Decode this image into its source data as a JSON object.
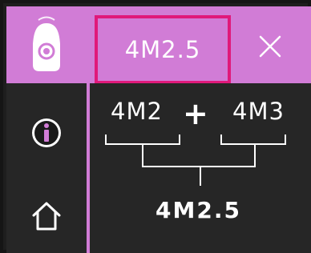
{
  "header": {
    "current_value": "4M2.5"
  },
  "sidebar": {
    "items": [
      {
        "name": "device-mode",
        "icon": "device-icon",
        "active": true
      },
      {
        "name": "info",
        "icon": "info-icon",
        "active": false
      },
      {
        "name": "home",
        "icon": "home-icon",
        "active": false
      }
    ]
  },
  "calculation": {
    "term_left": "4M2",
    "operator": "+",
    "term_right": "4M3",
    "result": "4M2.5"
  },
  "colors": {
    "accent": "#d17cd6",
    "highlight_border": "#e0197a",
    "panel": "#262626",
    "text": "#ffffff"
  }
}
